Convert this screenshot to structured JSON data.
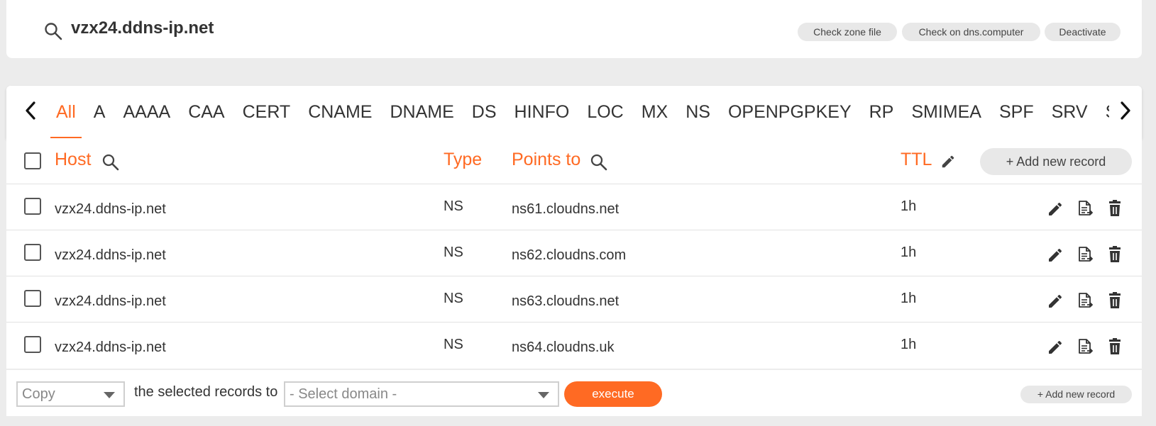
{
  "header": {
    "domain": "vzx24.ddns-ip.net",
    "buttons": {
      "check_zone": "Check zone file",
      "check_dns": "Check on dns.computer",
      "deactivate": "Deactivate"
    }
  },
  "tabs": [
    "All",
    "A",
    "AAAA",
    "CAA",
    "CERT",
    "CNAME",
    "DNAME",
    "DS",
    "HINFO",
    "LOC",
    "MX",
    "NS",
    "OPENPGPKEY",
    "RP",
    "SMIMEA",
    "SPF",
    "SRV",
    "SSHFP"
  ],
  "active_tab": "All",
  "table": {
    "headers": {
      "host": "Host",
      "type": "Type",
      "points_to": "Points to",
      "ttl": "TTL"
    },
    "add_record_label": "+ Add new record",
    "rows": [
      {
        "host": "vzx24.ddns-ip.net",
        "type": "NS",
        "points_to": "ns61.cloudns.net",
        "ttl": "1h"
      },
      {
        "host": "vzx24.ddns-ip.net",
        "type": "NS",
        "points_to": "ns62.cloudns.com",
        "ttl": "1h"
      },
      {
        "host": "vzx24.ddns-ip.net",
        "type": "NS",
        "points_to": "ns63.cloudns.net",
        "ttl": "1h"
      },
      {
        "host": "vzx24.ddns-ip.net",
        "type": "NS",
        "points_to": "ns64.cloudns.uk",
        "ttl": "1h"
      }
    ]
  },
  "footer": {
    "action_select": "Copy",
    "selected_text": "the selected records to",
    "domain_select_placeholder": "- Select domain -",
    "execute_label": "execute",
    "add_record_label": "+ Add new record"
  },
  "colors": {
    "accent": "#ff6a23",
    "pill_bg": "#e8e8e8",
    "page_bg": "#ececec"
  },
  "icons": [
    "search-icon",
    "chevron-left-icon",
    "chevron-right-icon",
    "pencil-icon",
    "copy-document-icon",
    "trash-icon"
  ]
}
